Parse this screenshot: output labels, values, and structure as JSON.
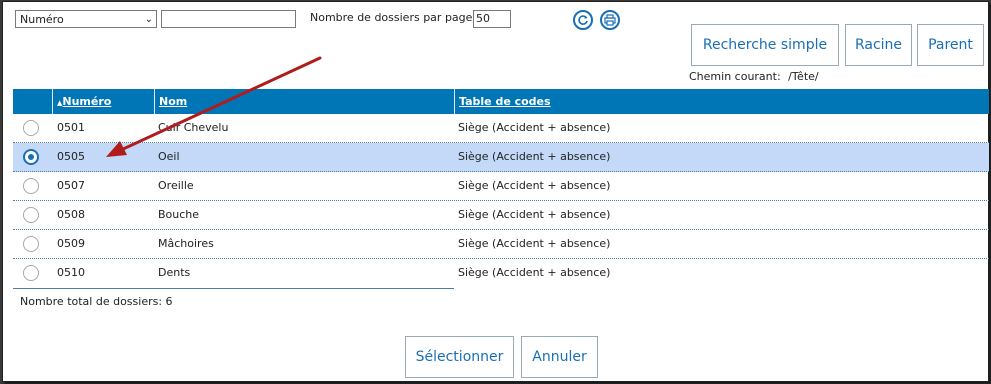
{
  "toolbar": {
    "sort_select_value": "Numéro",
    "search_value": "",
    "per_page_label": "Nombre de dossiers par page:",
    "per_page_value": "50",
    "refresh_icon": "refresh-icon",
    "print_icon": "print-icon"
  },
  "actions": {
    "simple_search": "Recherche simple",
    "root": "Racine",
    "parent": "Parent"
  },
  "path": {
    "label": "Chemin courant:",
    "value": "/Tête/"
  },
  "table": {
    "columns": [
      "Numéro",
      "Nom",
      "Table de codes"
    ],
    "sort_indicator": "▲",
    "rows": [
      {
        "numero": "0501",
        "nom": "Cuir Chevelu",
        "table": "Siège (Accident + absence)",
        "selected": false
      },
      {
        "numero": "0505",
        "nom": "Oeil",
        "table": "Siège (Accident + absence)",
        "selected": true
      },
      {
        "numero": "0507",
        "nom": "Oreille",
        "table": "Siège (Accident + absence)",
        "selected": false
      },
      {
        "numero": "0508",
        "nom": "Bouche",
        "table": "Siège (Accident + absence)",
        "selected": false
      },
      {
        "numero": "0509",
        "nom": "Mâchoires",
        "table": "Siège (Accident + absence)",
        "selected": false
      },
      {
        "numero": "0510",
        "nom": "Dents",
        "table": "Siège (Accident + absence)",
        "selected": false
      }
    ]
  },
  "footer": {
    "total_label": "Nombre total de dossiers: 6",
    "select_button": "Sélectionner",
    "cancel_button": "Annuler"
  },
  "colors": {
    "header_bg": "#0076b6",
    "selected_row_bg": "#c3d9f7",
    "accent": "#1a6fb3",
    "annotation_arrow": "#b01c1c"
  }
}
